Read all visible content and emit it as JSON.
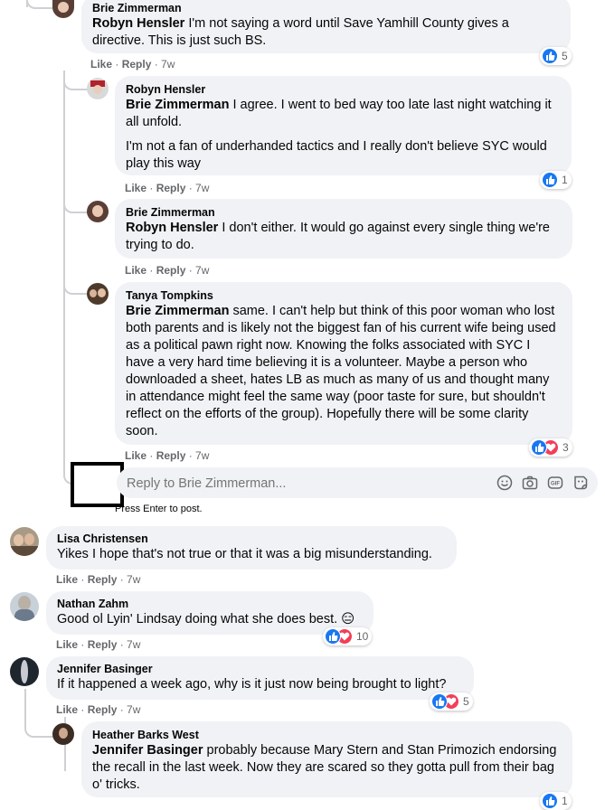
{
  "comments": [
    {
      "author": "Brie Zimmerman",
      "mention": "Robyn Hensler",
      "text": " I'm not saying a word until Save Yamhill County gives a directive. This is just such BS.",
      "like": "Like",
      "reply": "Reply",
      "time": "7w",
      "count": "5"
    },
    {
      "author": "Robyn Hensler",
      "mention": "Brie Zimmerman",
      "text": " I agree. I went to bed way too late last night watching it all unfold.",
      "text2": "I'm not a fan of underhanded tactics and I really don't believe SYC would play this way",
      "like": "Like",
      "reply": "Reply",
      "time": "7w",
      "count": "1"
    },
    {
      "author": "Brie Zimmerman",
      "mention": "Robyn Hensler",
      "text": " I don't either. It would go against every single thing we're trying to do.",
      "like": "Like",
      "reply": "Reply",
      "time": "7w"
    },
    {
      "author": "Tanya Tompkins",
      "mention": "Brie Zimmerman",
      "text": " same. I can't help but think of this poor woman who lost both parents and is likely not the biggest fan of his current wife being used as a political pawn right now. Knowing the folks associated with SYC I have a very hard time believing it is a volunteer. Maybe a person who downloaded a sheet, hates LB as much as many of us and thought many in attendance might feel the same way (poor taste for sure, but shouldn't reflect on the efforts of the group). Hopefully there will be some clarity soon.",
      "like": "Like",
      "reply": "Reply",
      "time": "7w",
      "count": "3"
    },
    {
      "author": "Lisa Christensen",
      "text": "Yikes I hope that's not true or that it was a big misunderstanding.",
      "like": "Like",
      "reply": "Reply",
      "time": "7w"
    },
    {
      "author": "Nathan Zahm",
      "text": "Good ol Lyin' Lindsay doing what she does best. 😑",
      "like": "Like",
      "reply": "Reply",
      "time": "7w",
      "count": "10"
    },
    {
      "author": "Jennifer Basinger",
      "text": "If it happened a week ago, why is it just now being brought to light?",
      "like": "Like",
      "reply": "Reply",
      "time": "7w",
      "count": "5"
    },
    {
      "author": "Heather Barks West",
      "mention": "Jennifer Basinger",
      "text": " probably because Mary Stern and Stan Primozich endorsing the recall in the last week. Now they are scared so they gotta pull from their bag o' tricks.",
      "count": "1"
    }
  ],
  "reply_box": {
    "placeholder": "Reply to Brie Zimmerman...",
    "hint": "Press Enter to post."
  },
  "colors": {
    "like": "#1877f2",
    "love": "#f33e58",
    "bubble": "#f0f2f5",
    "meta": "#65676b"
  }
}
